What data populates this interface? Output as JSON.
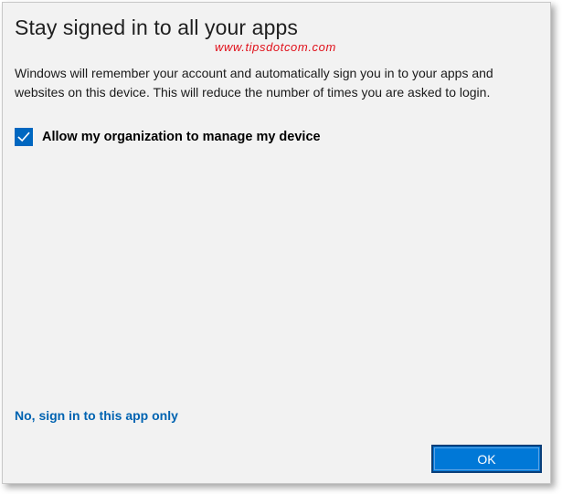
{
  "dialog": {
    "title": "Stay signed in to all your apps",
    "watermark": "www.tipsdotcom.com",
    "description_line1": "Windows will remember your account and automatically sign you in to your apps and",
    "description_line2": "websites on this device. This will reduce the number of times you are asked to login.",
    "checkbox": {
      "label": "Allow my organization to manage my device",
      "checked": true,
      "icon": "checkmark-icon"
    },
    "secondary_link": "No, sign in to this app only",
    "ok_label": "OK"
  },
  "colors": {
    "background": "#f2f2f2",
    "accent": "#0078d7",
    "link": "#0063b1",
    "watermark": "#e0101a"
  }
}
